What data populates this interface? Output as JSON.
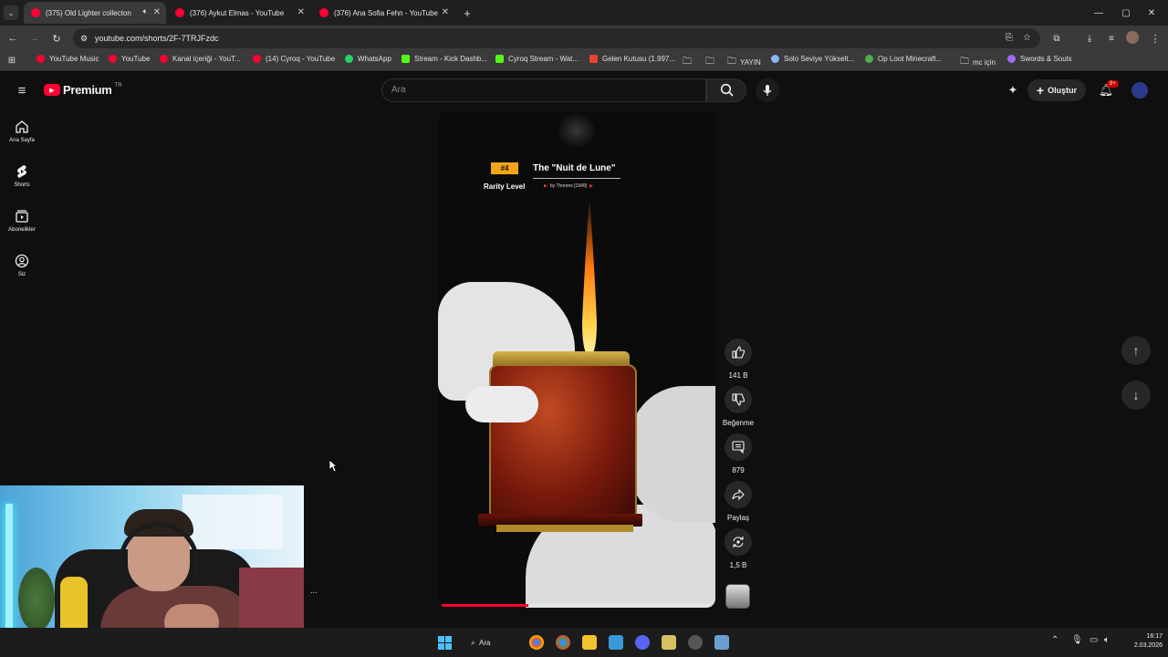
{
  "tabs": [
    {
      "title": "(375) Old Lighter collecton",
      "active": true
    },
    {
      "title": "(376) Aykut Elmas - YouTube",
      "active": false
    },
    {
      "title": "(376) Ana Sofia Fehn - YouTube",
      "active": false
    }
  ],
  "new_tab_icon": "+",
  "address": {
    "url": "youtube.com/shorts/2F-7TRJFzdc"
  },
  "bookmarks": [
    {
      "label": "YouTube Music",
      "color": "#ff0033"
    },
    {
      "label": "YouTube",
      "color": "#ff0033"
    },
    {
      "label": "Kanal içeriği - YouT...",
      "color": "#ff0033"
    },
    {
      "label": "(14) Cyroq - YouTube",
      "color": "#ff0033"
    },
    {
      "label": "WhatsApp",
      "color": "#25d366"
    },
    {
      "label": "Stream - Kick Dashb...",
      "color": "#53fc18"
    },
    {
      "label": "Cyroq Stream - Wat...",
      "color": "#53fc18"
    },
    {
      "label": "Gelen Kutusu (1.997...",
      "color": "#ea4335"
    },
    {
      "label": "",
      "color": "#bbbbbb"
    },
    {
      "label": "YAYIN",
      "color": "#bbbbbb"
    },
    {
      "label": "Solo Seviye Yükselt...",
      "color": "#8ab4f8"
    },
    {
      "label": "Op Loot Minecraft...",
      "color": "#4caf50"
    },
    {
      "label": "mc için",
      "color": "#bbbbbb"
    },
    {
      "label": "Swords & Souls",
      "color": "#9c6cf0"
    }
  ],
  "youtube": {
    "logo_text": "Premium",
    "country": "TR",
    "search_placeholder": "Ara",
    "create_label": "Oluştur",
    "notif_badge": "9+"
  },
  "sidenav": [
    {
      "label": "Ana Sayfa",
      "icon": "home-icon"
    },
    {
      "label": "Shorts",
      "icon": "shorts-icon"
    },
    {
      "label": "Abonelikler",
      "icon": "subscriptions-icon"
    },
    {
      "label": "Siz",
      "icon": "account-icon"
    }
  ],
  "video": {
    "rank": "#4",
    "title": "The \"Nuit de Lune\"",
    "rarity": "Rarity Level",
    "byline": "by Thorens [1949]",
    "progress": 0.32
  },
  "actions": {
    "likes": "141 B",
    "dislike": "Beğenme",
    "comments": "879",
    "share": "Paylaş",
    "remix": "1,5 B"
  },
  "clock": {
    "time": "16:17",
    "date": "2.03.2026"
  },
  "taskbar": {
    "search_label": "Ara"
  },
  "overlay_text": "..."
}
